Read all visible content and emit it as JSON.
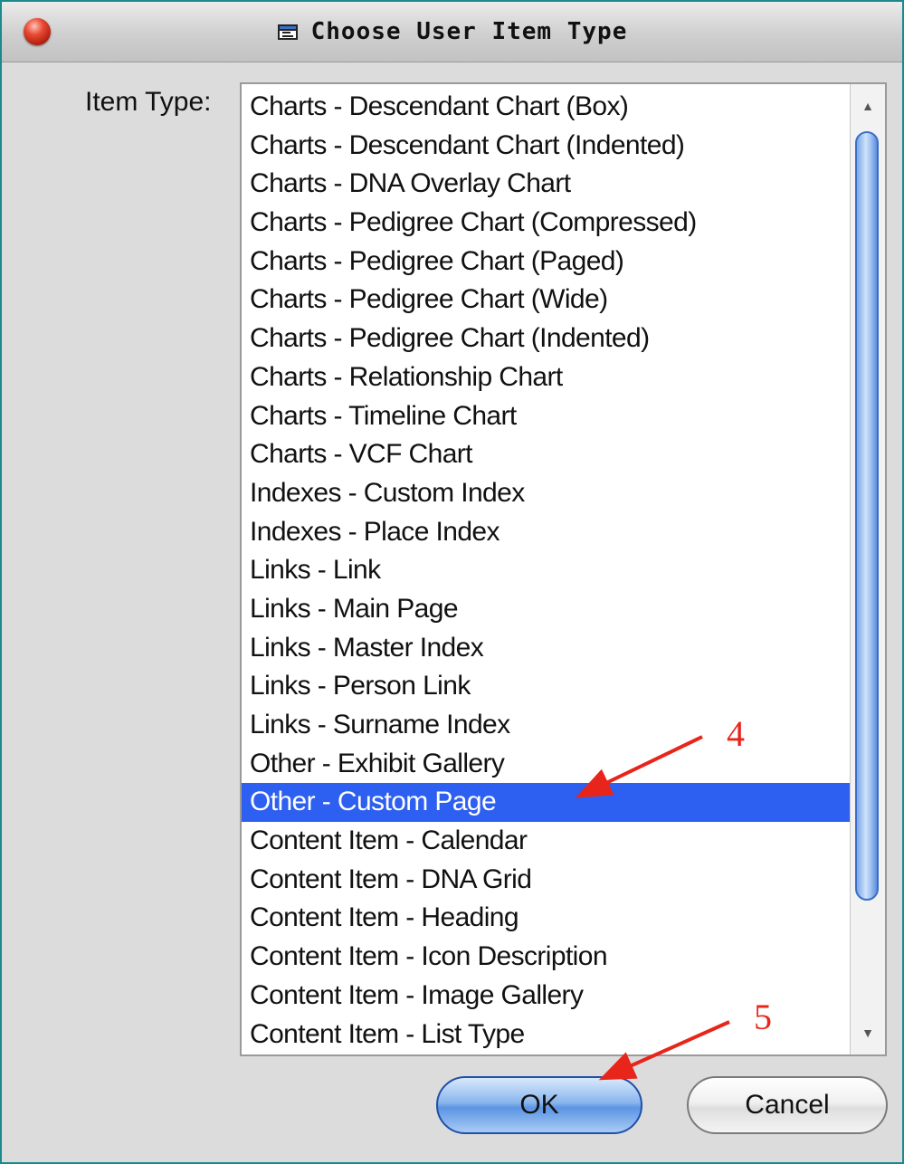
{
  "window": {
    "title": "Choose User Item Type"
  },
  "form": {
    "label": "Item Type:"
  },
  "list": {
    "items": [
      "Charts - Descendant Chart (Box)",
      "Charts - Descendant Chart (Indented)",
      "Charts - DNA Overlay Chart",
      "Charts - Pedigree Chart (Compressed)",
      "Charts - Pedigree Chart (Paged)",
      "Charts - Pedigree Chart (Wide)",
      "Charts - Pedigree Chart (Indented)",
      "Charts - Relationship Chart",
      "Charts - Timeline Chart",
      "Charts - VCF Chart",
      "Indexes - Custom Index",
      "Indexes - Place Index",
      "Links - Link",
      "Links - Main Page",
      "Links - Master Index",
      "Links - Person Link",
      "Links - Surname Index",
      "Other - Exhibit Gallery",
      "Other - Custom Page",
      "Content Item - Calendar",
      "Content Item - DNA Grid",
      "Content Item - Heading",
      "Content Item - Icon Description",
      "Content Item - Image Gallery",
      "Content Item - List Type"
    ],
    "selected_item": "Other - Custom Page"
  },
  "buttons": {
    "ok": "OK",
    "cancel": "Cancel"
  },
  "annotations": {
    "step4": "4",
    "step5": "5",
    "arrow_color": "#e8251a"
  },
  "colors": {
    "selection": "#2d5ff0",
    "desktop": "#1a8a8c"
  }
}
